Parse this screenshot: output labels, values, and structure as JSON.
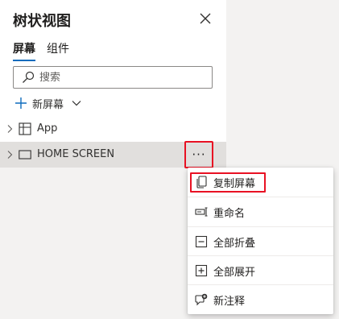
{
  "panel": {
    "title": "树状视图",
    "tabs": [
      {
        "label": "屏幕",
        "active": true
      },
      {
        "label": "组件",
        "active": false
      }
    ],
    "search": {
      "placeholder": "搜索",
      "value": ""
    },
    "new_screen_label": "新屏幕"
  },
  "tree": [
    {
      "label": "App",
      "icon": "app-grid-icon"
    },
    {
      "label": "HOME SCREEN",
      "icon": "screen-icon",
      "selected": true
    }
  ],
  "more_button_label": "···",
  "context_menu": {
    "items": [
      {
        "label": "复制屏幕",
        "icon": "duplicate-icon"
      },
      {
        "label": "重命名",
        "icon": "rename-icon"
      },
      {
        "label": "全部折叠",
        "icon": "collapse-all-icon"
      },
      {
        "label": "全部展开",
        "icon": "expand-all-icon"
      },
      {
        "label": "新注释",
        "icon": "new-comment-icon"
      }
    ]
  },
  "colors": {
    "accent": "#0f6cbd",
    "highlight": "#e81123",
    "selected_row": "#e1dfdd",
    "panel_bg": "#f3f2f1"
  }
}
